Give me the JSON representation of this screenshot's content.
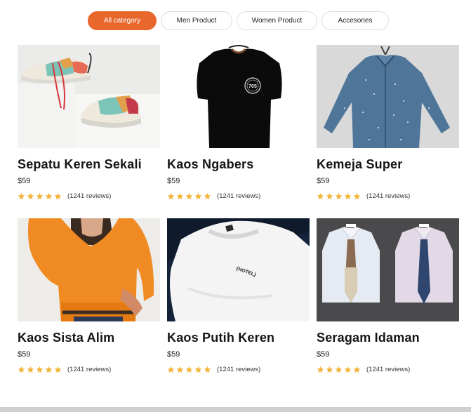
{
  "tabs": [
    {
      "label": "All category",
      "active": true
    },
    {
      "label": "Men Product",
      "active": false
    },
    {
      "label": "Women Product",
      "active": false
    },
    {
      "label": "Accesories",
      "active": false
    }
  ],
  "products": [
    {
      "title": "Sepatu Keren Sekali",
      "price": "$59",
      "rating": 5,
      "reviews": "(1241 reviews)",
      "image": "sneakers"
    },
    {
      "title": "Kaos Ngabers",
      "price": "$59",
      "rating": 5,
      "reviews": "(1241 reviews)",
      "image": "black-tshirt"
    },
    {
      "title": "Kemeja Super",
      "price": "$59",
      "rating": 5,
      "reviews": "(1241 reviews)",
      "image": "denim-shirt"
    },
    {
      "title": "Kaos Sista Alim",
      "price": "$59",
      "rating": 5,
      "reviews": "(1241 reviews)",
      "image": "orange-sweater"
    },
    {
      "title": "Kaos Putih Keren",
      "price": "$59",
      "rating": 5,
      "reviews": "(1241 reviews)",
      "image": "white-tshirt"
    },
    {
      "title": "Seragam Idaman",
      "price": "$59",
      "rating": 5,
      "reviews": "(1241 reviews)",
      "image": "dress-shirts"
    }
  ],
  "image_text": {
    "tshirt_badge": "705",
    "white_tshirt_print": "{HOTEL}"
  },
  "colors": {
    "accent": "#e8672d",
    "star": "#f2b53a"
  }
}
